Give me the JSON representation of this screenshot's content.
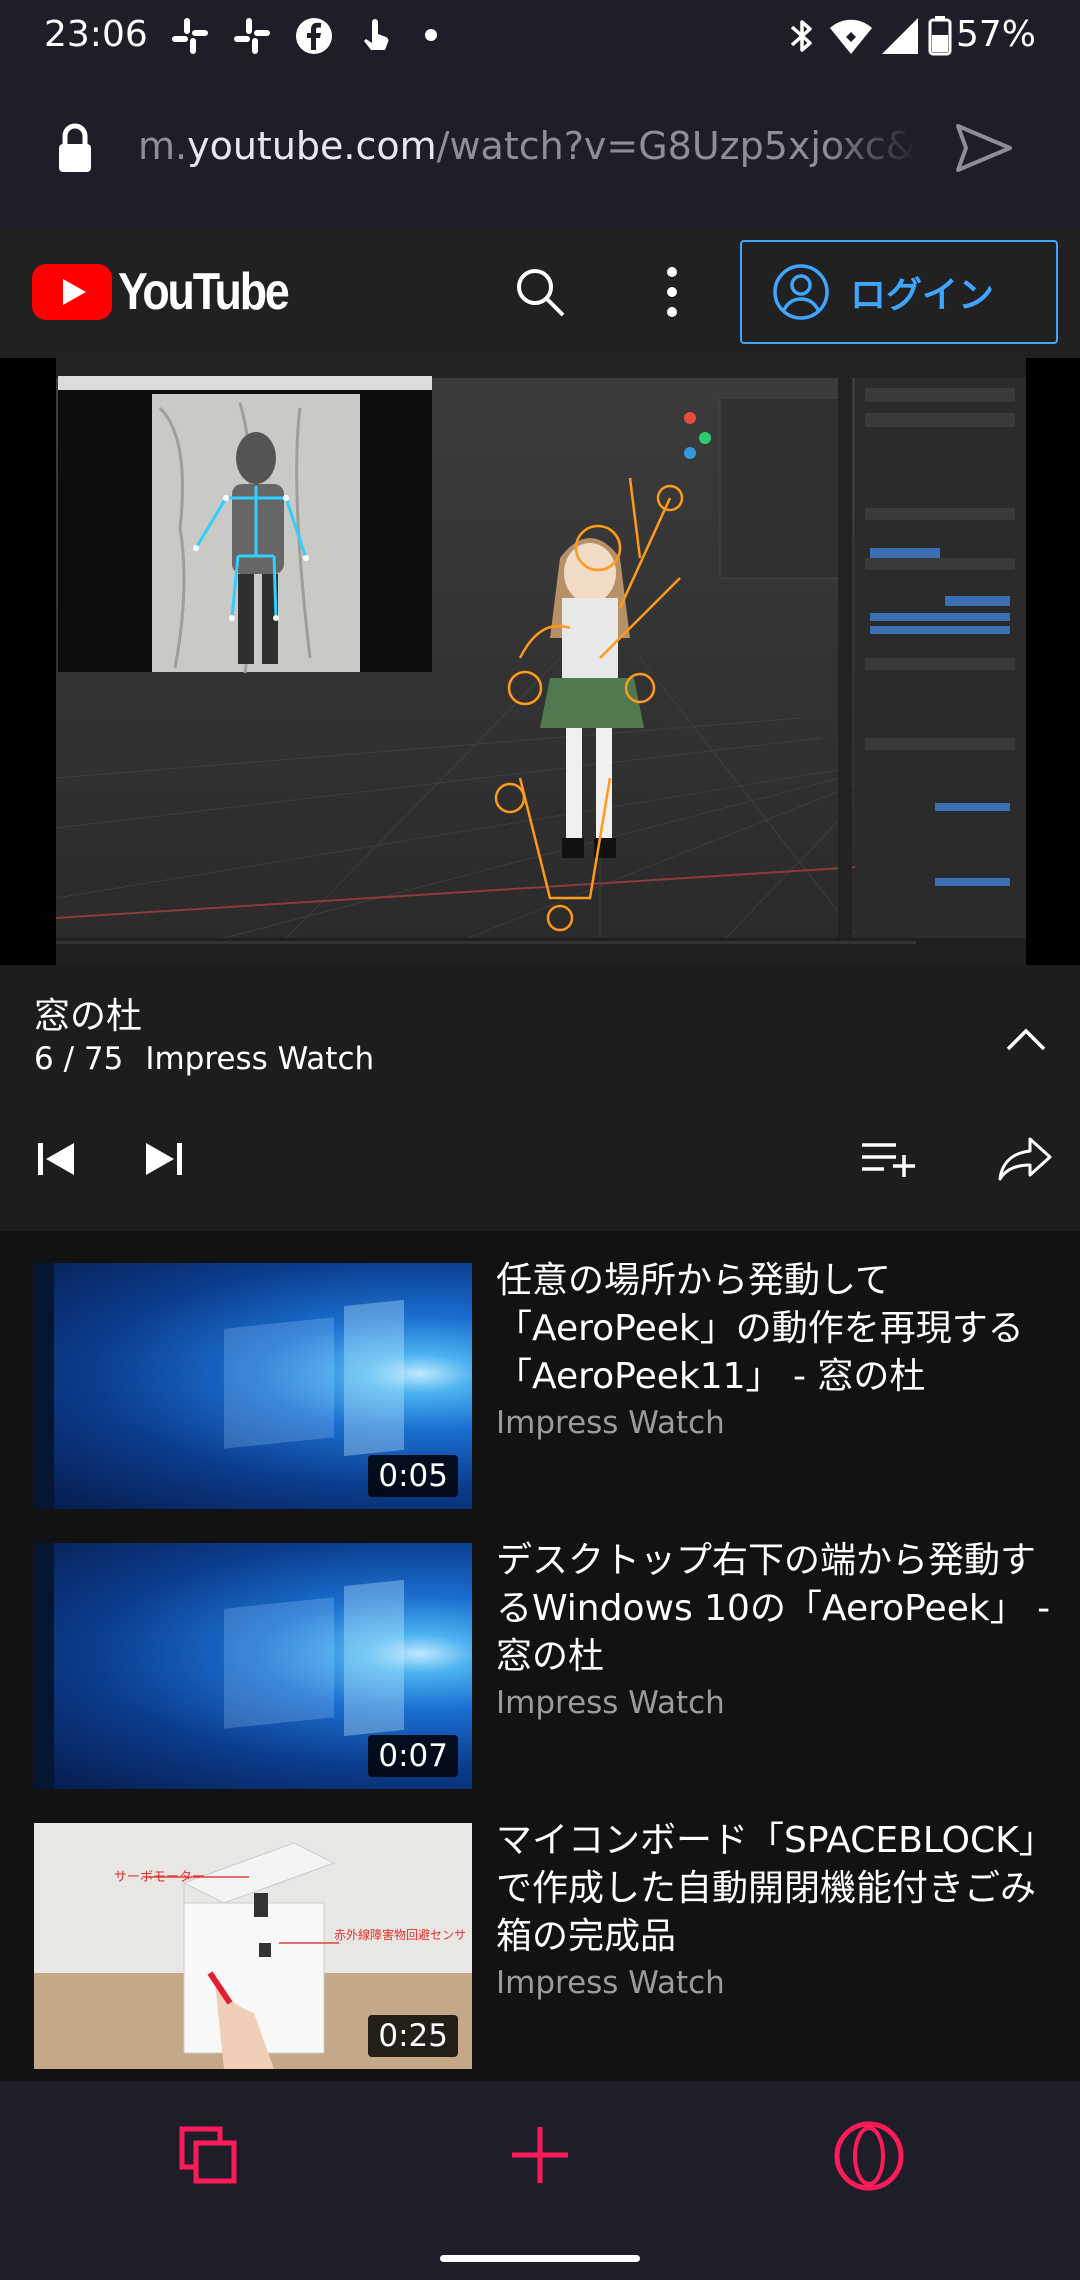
{
  "status_bar": {
    "time": "23:06",
    "battery": "57%",
    "icons": [
      "slack-icon",
      "slack-icon",
      "facebook-icon",
      "touch-icon",
      "dot-icon",
      "bluetooth-icon",
      "wifi-icon",
      "signal-icon",
      "battery-icon"
    ]
  },
  "browser": {
    "url_prefix": "m.",
    "url_host": "youtube.com",
    "url_path": "/watch?v=G8Uzp5xjoxc&",
    "icons": [
      "lock-icon",
      "send-icon"
    ]
  },
  "youtube_header": {
    "logo_text": "YouTube",
    "login_label": "ログイン",
    "icons": [
      "youtube-logo-icon",
      "search-icon",
      "more-vert-icon",
      "account-icon"
    ]
  },
  "playlist": {
    "title": "窓の杜",
    "position": "6 / 75",
    "channel": "Impress Watch",
    "icons": [
      "chevron-up-icon",
      "skip-previous-icon",
      "skip-next-icon",
      "add-to-queue-icon",
      "share-icon"
    ]
  },
  "items": [
    {
      "title": "任意の場所から発動して「AeroPeek」の動作を再現する「AeroPeek11」 - 窓の杜",
      "channel": "Impress Watch",
      "duration": "0:05"
    },
    {
      "title": "デスクトップ右下の端から発動するWindows 10の「AeroPeek」 - 窓の杜",
      "channel": "Impress Watch",
      "duration": "0:07"
    },
    {
      "title": "マイコンボード「SPACEBLOCK」で作成した自動開閉機能付きごみ箱の完成品",
      "channel": "Impress Watch",
      "duration": "0:25"
    }
  ],
  "thumb3_labels": {
    "servo": "サーボモーター",
    "sensor": "赤外線障害物回避センサ"
  },
  "bottom_nav": {
    "icons": [
      "tabs-icon",
      "plus-icon",
      "opera-icon"
    ]
  },
  "colors": {
    "accent_red": "#ff0000",
    "login_blue": "#3ea6ff",
    "opera_pink": "#ff1b5a"
  }
}
